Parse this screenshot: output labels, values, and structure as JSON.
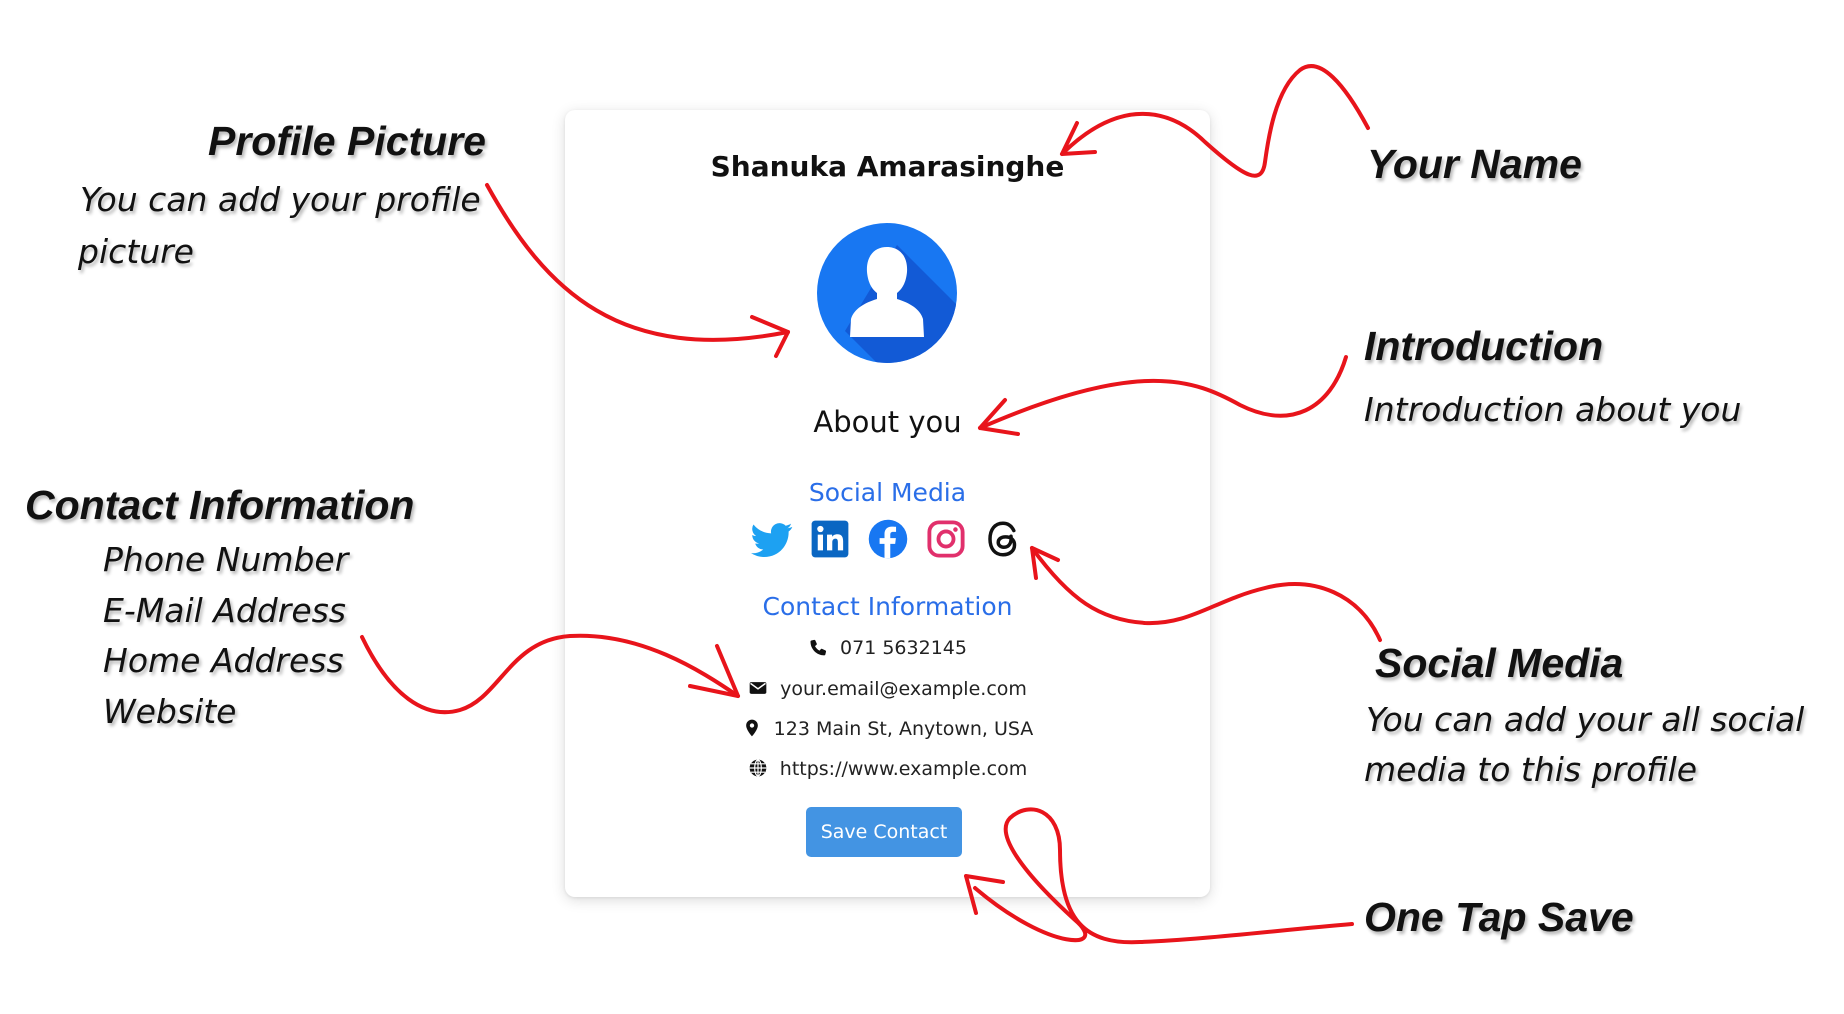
{
  "card": {
    "name": "Shanuka Amarasinghe",
    "about": "About you",
    "social_heading": "Social Media",
    "social_icons": [
      "twitter-icon",
      "linkedin-icon",
      "facebook-icon",
      "instagram-icon",
      "threads-icon"
    ],
    "contact_heading": "Contact Information",
    "phone": "071 5632145",
    "email": "your.email@example.com",
    "address": "123 Main St, Anytown, USA",
    "website": "https://www.example.com",
    "save_label": "Save Contact"
  },
  "annotations": {
    "profile_picture": {
      "title": "Profile Picture",
      "line1": "You can add your profile",
      "line2": "picture"
    },
    "your_name": {
      "title": "Your Name"
    },
    "introduction": {
      "title": "Introduction",
      "line1": "Introduction about you"
    },
    "contact_information": {
      "title": "Contact Information",
      "items": [
        "Phone Number",
        "E-Mail Address",
        "Home Address",
        "Website"
      ]
    },
    "social_media": {
      "title": "Social Media",
      "line1": "You can add your all social",
      "line2": "media to this profile"
    },
    "one_tap_save": {
      "title": "One Tap Save"
    }
  },
  "colors": {
    "accent": "#2a6ee8",
    "button": "#4394e3",
    "arrow": "#e8141b",
    "avatar": "#1877f2",
    "twitter": "#1da1f2",
    "linkedin": "#0a66c2",
    "facebook": "#1877f2",
    "instagram": "#e1306c"
  }
}
